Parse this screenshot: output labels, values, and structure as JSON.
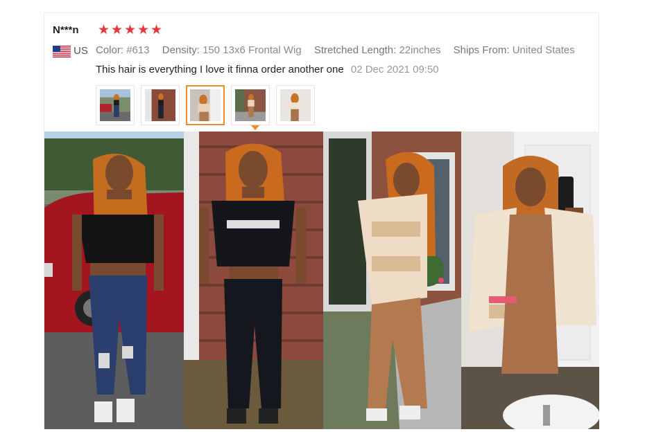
{
  "review": {
    "username": "N***n",
    "rating": 5,
    "stars": [
      "★",
      "★",
      "★",
      "★",
      "★"
    ],
    "country_code": "US",
    "flag_icon": "us-flag-icon",
    "specs": [
      {
        "key": "Color:",
        "value": "#613"
      },
      {
        "key": "Density:",
        "value": "150 13x6 Frontal Wig"
      },
      {
        "key": "Stretched Length:",
        "value": "22inches"
      },
      {
        "key": "Ships From:",
        "value": "United States"
      }
    ],
    "comment": "This hair is everything I love it finna order another one",
    "date": "02 Dec 2021 09:50",
    "selected_thumbnail_index": 2,
    "thumbnails_count": 5
  },
  "colors": {
    "star": "#e8343c",
    "active_border": "#f08a2c"
  }
}
